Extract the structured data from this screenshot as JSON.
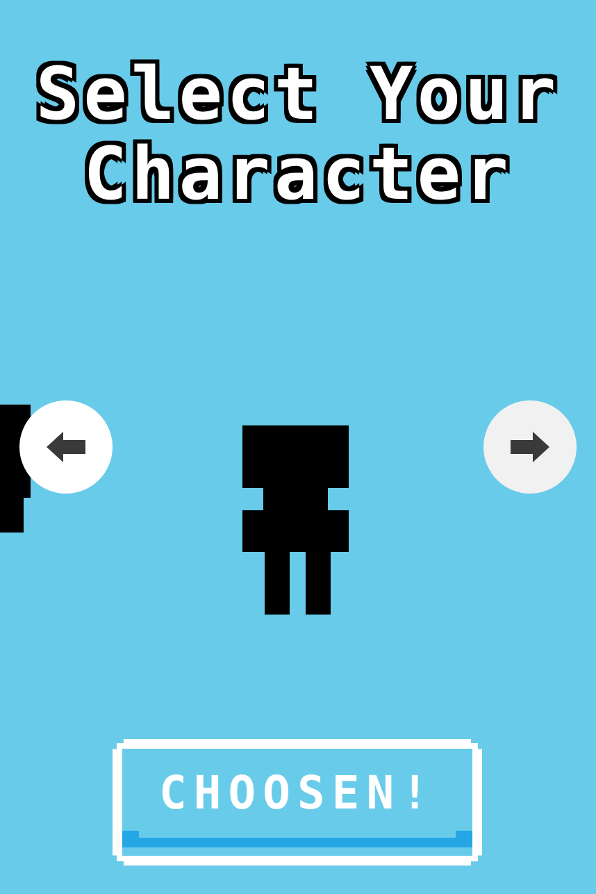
{
  "screen": {
    "title_line1": "Select Your",
    "title_line2": "Character",
    "background_color": "#68cbea"
  },
  "controls": {
    "prev_icon": "arrow-left-icon",
    "next_icon": "arrow-right-icon"
  },
  "confirm_button": {
    "label": "CHOOSEN!",
    "accent_color": "#26a7e5"
  }
}
